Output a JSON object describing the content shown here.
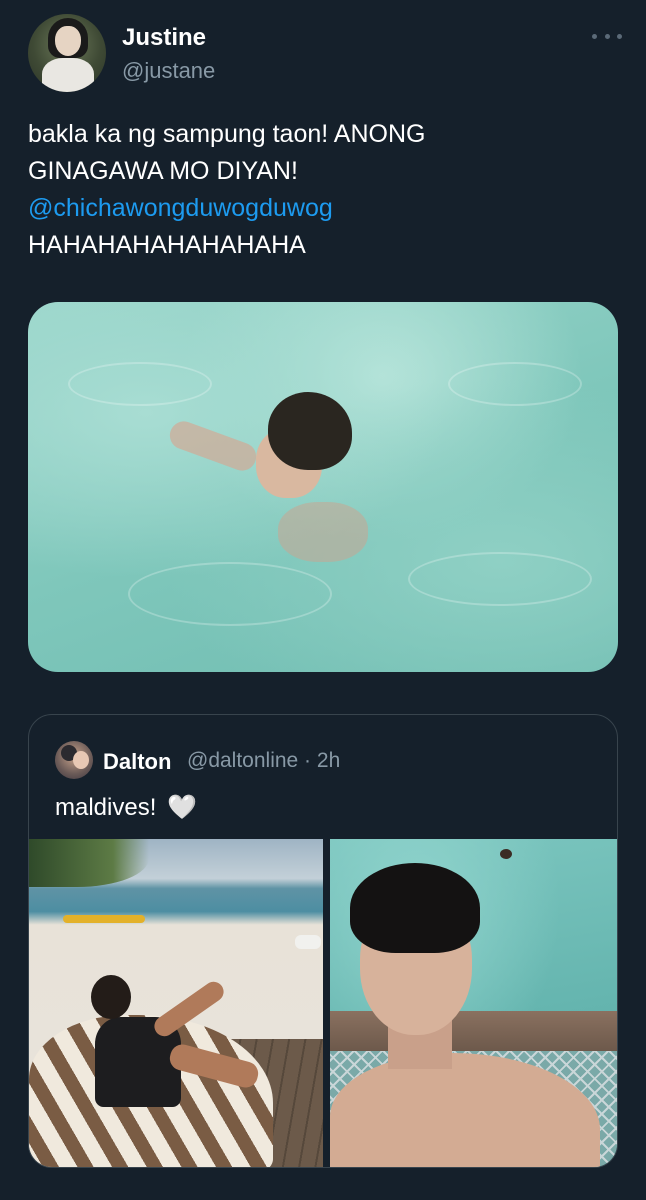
{
  "tweet": {
    "display_name": "Justine",
    "handle": "@justane",
    "text_lines": [
      "bakla ka ng sampung taon! ANONG",
      "GINAGAWA MO DIYAN!"
    ],
    "mention": "@chichawongduwogduwog",
    "text_tail": "HAHAHAHAHAHAHAHA"
  },
  "quote": {
    "display_name": "Dalton",
    "handle_time": "@daltonline · 2h",
    "text": "maldives!",
    "emoji": "🤍"
  },
  "colors": {
    "background": "#15202b",
    "link": "#1d9bf0",
    "secondary_text": "#8899a6",
    "border": "#38444d"
  },
  "icons": {
    "more": "more-horizontal-icon",
    "heart": "white-heart-icon"
  }
}
